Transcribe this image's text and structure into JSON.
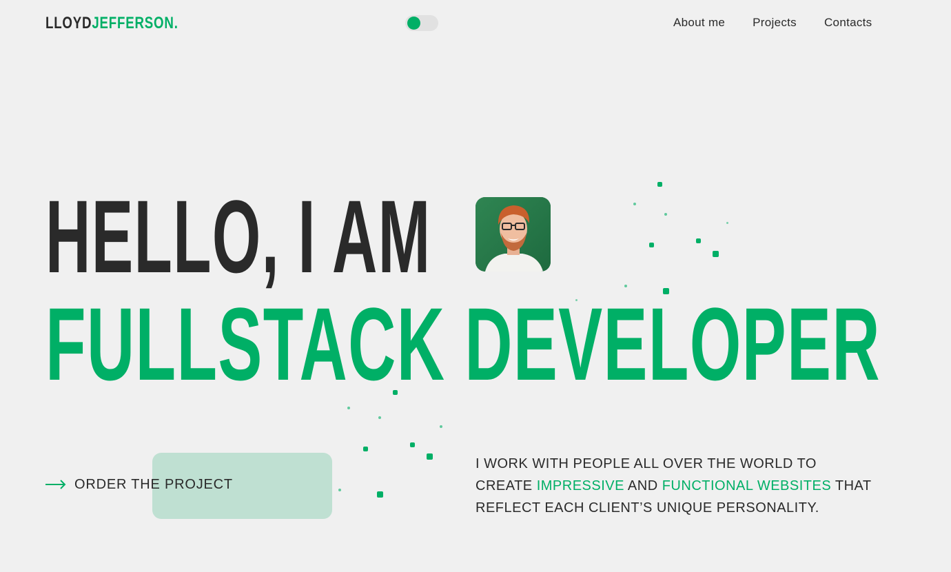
{
  "header": {
    "logo_first": "LLOYD",
    "logo_last": "JEFFERSON.",
    "nav": [
      {
        "label": "About me"
      },
      {
        "label": "Projects"
      },
      {
        "label": "Contacts"
      }
    ],
    "theme_toggle": {
      "state": "on"
    }
  },
  "hero": {
    "line1": "HELLO, I AM",
    "line2": "FULLSTACK DEVELOPER",
    "cta_label": "ORDER THE PROJECT",
    "description": {
      "part1": "I WORK WITH PEOPLE ALL OVER THE WORLD TO CREATE",
      "accent1": "IMPRESSIVE",
      "part2": "AND",
      "accent2": "FUNCTIONAL WEBSITES",
      "part3": "THAT REFLECT EACH CLIENT’S UNIQUE PERSONALITY."
    }
  },
  "colors": {
    "accent": "#00af66",
    "text": "#2a2a2a",
    "background": "#f0f0f0",
    "cta_highlight": "#bfe0d2"
  },
  "icons": {
    "cta_icon": "arrow-right-icon",
    "avatar": "portrait-photo"
  }
}
